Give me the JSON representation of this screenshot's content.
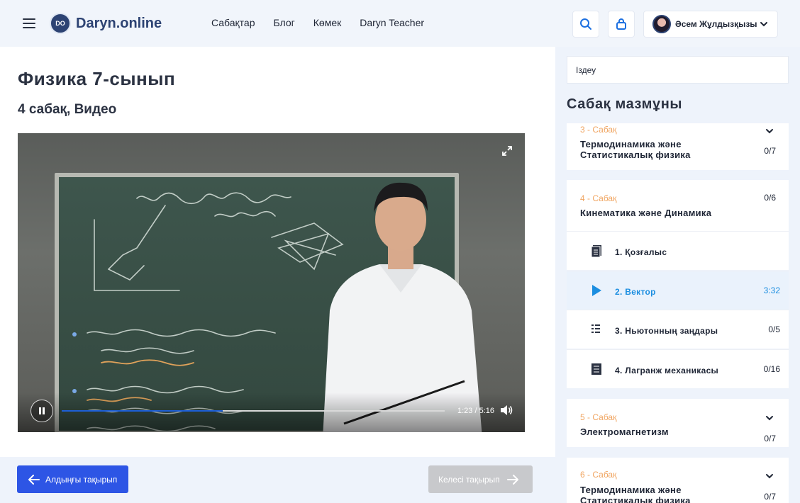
{
  "brand": {
    "logo_mark": "DO",
    "name": "Daryn.online"
  },
  "nav": [
    {
      "label": "Сабақтар"
    },
    {
      "label": "Блог"
    },
    {
      "label": "Көмек"
    },
    {
      "label": "Daryn Teacher"
    }
  ],
  "header": {
    "search_icon": "search-icon",
    "cart_icon": "shopping-bag-icon",
    "user_name": "Әсем Жұлдызқызы"
  },
  "course": {
    "title": "Физика 7-сынып",
    "subtitle": "4 сабақ, Видео"
  },
  "video": {
    "time": "1:23 / 5:16",
    "progress": 0.42,
    "state": "playing"
  },
  "nav_buttons": {
    "prev": "Алдыңғы тақырып",
    "next": "Келесі тақырып"
  },
  "sidebar": {
    "search_value": "Іздеу",
    "title": "Сабақ мазмұны",
    "lessons": [
      {
        "number": "3 - Сабақ",
        "name_line1": "Термодинамика және",
        "name_line2": "Статистикалық физика",
        "count": "0/7"
      },
      {
        "number": "4 - Сабақ",
        "name_line1": "Кинематика және Динамика",
        "count": "0/6",
        "items": [
          {
            "label": "1. Қозғалыс",
            "meta": "",
            "icon": "document-icon"
          },
          {
            "label": "2. Вектор",
            "meta": "3:32",
            "icon": "play-icon"
          },
          {
            "label": "3. Ньютонның заңдары",
            "meta": "0/5",
            "icon": "quiz-icon"
          },
          {
            "label": "4. Лагранж механикасы",
            "meta": "0/16",
            "icon": "test-icon"
          }
        ]
      },
      {
        "number": "5 - Сабақ",
        "name_line1": "Электромагнетизм",
        "count": "0/7"
      },
      {
        "number": "6 - Сабақ",
        "name_line1": "Термодинамика және",
        "name_line2": "Статистикалық физика",
        "count": "0/7"
      }
    ]
  },
  "colors": {
    "accent": "#2d55e5",
    "active": "#1c8ee0",
    "lesson_number": "#f0a561",
    "brand": "#2d4373"
  }
}
